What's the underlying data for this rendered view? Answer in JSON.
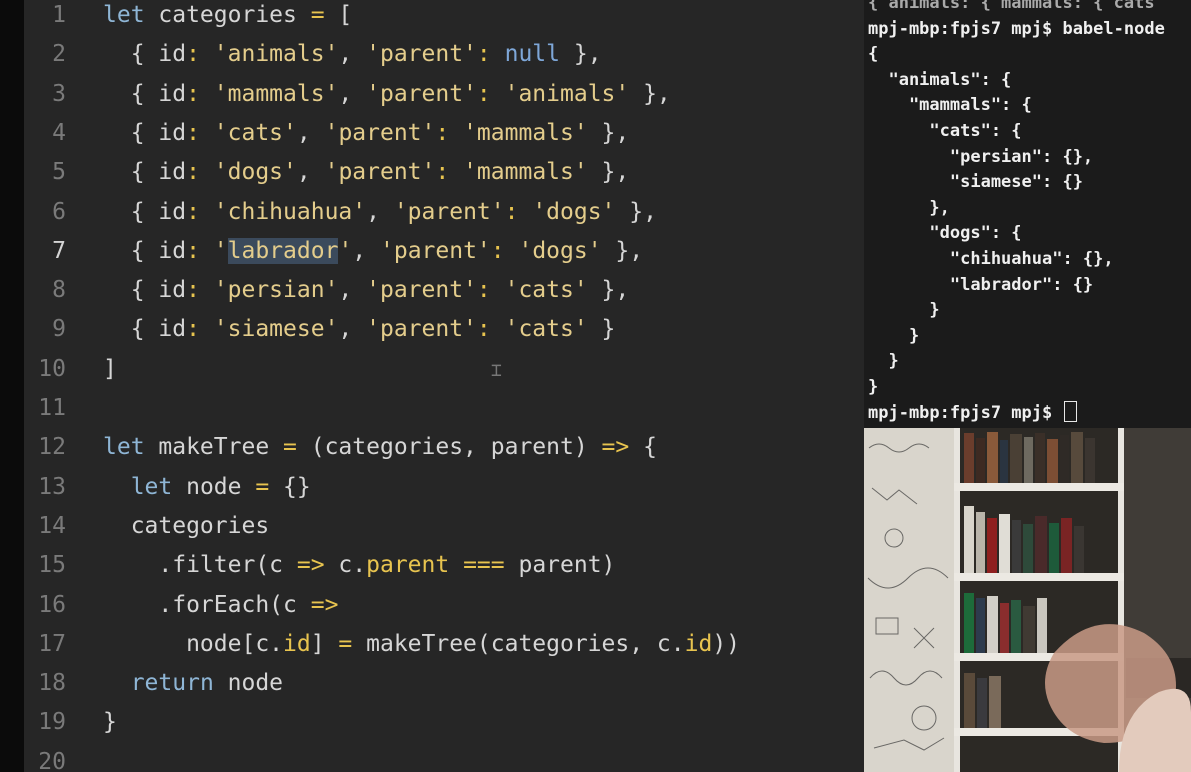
{
  "editor": {
    "active_line": 7,
    "lines": [
      {
        "n": "1",
        "tokens": [
          [
            "let",
            "kw"
          ],
          [
            " categories ",
            "id"
          ],
          [
            "=",
            "op"
          ],
          [
            " [",
            "punc"
          ]
        ]
      },
      {
        "n": "2",
        "tokens": [
          [
            "  { ",
            "punc"
          ],
          [
            "id",
            "prop"
          ],
          [
            ": ",
            "op"
          ],
          [
            "'animals'",
            "str"
          ],
          [
            ", ",
            "punc"
          ],
          [
            "'parent'",
            "str"
          ],
          [
            ": ",
            "op"
          ],
          [
            "null",
            "null"
          ],
          [
            " },",
            "punc"
          ]
        ]
      },
      {
        "n": "3",
        "tokens": [
          [
            "  { ",
            "punc"
          ],
          [
            "id",
            "prop"
          ],
          [
            ": ",
            "op"
          ],
          [
            "'mammals'",
            "str"
          ],
          [
            ", ",
            "punc"
          ],
          [
            "'parent'",
            "str"
          ],
          [
            ": ",
            "op"
          ],
          [
            "'animals'",
            "str"
          ],
          [
            " },",
            "punc"
          ]
        ]
      },
      {
        "n": "4",
        "tokens": [
          [
            "  { ",
            "punc"
          ],
          [
            "id",
            "prop"
          ],
          [
            ": ",
            "op"
          ],
          [
            "'cats'",
            "str"
          ],
          [
            ", ",
            "punc"
          ],
          [
            "'parent'",
            "str"
          ],
          [
            ": ",
            "op"
          ],
          [
            "'mammals'",
            "str"
          ],
          [
            " },",
            "punc"
          ]
        ]
      },
      {
        "n": "5",
        "tokens": [
          [
            "  { ",
            "punc"
          ],
          [
            "id",
            "prop"
          ],
          [
            ": ",
            "op"
          ],
          [
            "'dogs'",
            "str"
          ],
          [
            ", ",
            "punc"
          ],
          [
            "'parent'",
            "str"
          ],
          [
            ": ",
            "op"
          ],
          [
            "'mammals'",
            "str"
          ],
          [
            " },",
            "punc"
          ]
        ]
      },
      {
        "n": "6",
        "tokens": [
          [
            "  { ",
            "punc"
          ],
          [
            "id",
            "prop"
          ],
          [
            ": ",
            "op"
          ],
          [
            "'chihuahua'",
            "str"
          ],
          [
            ", ",
            "punc"
          ],
          [
            "'parent'",
            "str"
          ],
          [
            ": ",
            "op"
          ],
          [
            "'dogs'",
            "str"
          ],
          [
            " },",
            "punc"
          ]
        ]
      },
      {
        "n": "7",
        "tokens": [
          [
            "  { ",
            "punc"
          ],
          [
            "id",
            "prop"
          ],
          [
            ": ",
            "op"
          ],
          [
            "'",
            "str"
          ],
          [
            "labrador",
            "sel"
          ],
          [
            "'",
            "str"
          ],
          [
            ", ",
            "punc"
          ],
          [
            "'parent'",
            "str"
          ],
          [
            ": ",
            "op"
          ],
          [
            "'dogs'",
            "str"
          ],
          [
            " },",
            "punc"
          ]
        ]
      },
      {
        "n": "8",
        "tokens": [
          [
            "  { ",
            "punc"
          ],
          [
            "id",
            "prop"
          ],
          [
            ": ",
            "op"
          ],
          [
            "'persian'",
            "str"
          ],
          [
            ", ",
            "punc"
          ],
          [
            "'parent'",
            "str"
          ],
          [
            ": ",
            "op"
          ],
          [
            "'cats'",
            "str"
          ],
          [
            " },",
            "punc"
          ]
        ]
      },
      {
        "n": "9",
        "tokens": [
          [
            "  { ",
            "punc"
          ],
          [
            "id",
            "prop"
          ],
          [
            ": ",
            "op"
          ],
          [
            "'siamese'",
            "str"
          ],
          [
            ", ",
            "punc"
          ],
          [
            "'parent'",
            "str"
          ],
          [
            ": ",
            "op"
          ],
          [
            "'cats'",
            "str"
          ],
          [
            " }",
            "punc"
          ]
        ]
      },
      {
        "n": "10",
        "tokens": [
          [
            "]",
            "punc"
          ]
        ]
      },
      {
        "n": "11",
        "tokens": []
      },
      {
        "n": "12",
        "tokens": [
          [
            "let",
            "kw"
          ],
          [
            " makeTree ",
            "id"
          ],
          [
            "=",
            "op"
          ],
          [
            " (categories, parent) ",
            "id"
          ],
          [
            "=>",
            "op"
          ],
          [
            " {",
            "punc"
          ]
        ]
      },
      {
        "n": "13",
        "tokens": [
          [
            "  ",
            "id"
          ],
          [
            "let",
            "kw"
          ],
          [
            " node ",
            "id"
          ],
          [
            "=",
            "op"
          ],
          [
            " {}",
            "punc"
          ]
        ]
      },
      {
        "n": "14",
        "tokens": [
          [
            "  categories",
            "id"
          ]
        ]
      },
      {
        "n": "15",
        "tokens": [
          [
            "    .filter(c ",
            "id"
          ],
          [
            "=>",
            "op"
          ],
          [
            " c.",
            "id"
          ],
          [
            "parent",
            "mem"
          ],
          [
            " ",
            "id"
          ],
          [
            "===",
            "op"
          ],
          [
            " parent)",
            "id"
          ]
        ]
      },
      {
        "n": "16",
        "tokens": [
          [
            "    .forEach(c ",
            "id"
          ],
          [
            "=>",
            "op"
          ]
        ]
      },
      {
        "n": "17",
        "tokens": [
          [
            "      node[c.",
            "id"
          ],
          [
            "id",
            "mem"
          ],
          [
            "] ",
            "id"
          ],
          [
            "=",
            "op"
          ],
          [
            " makeTree(categories, c.",
            "id"
          ],
          [
            "id",
            "mem"
          ],
          [
            "))",
            "id"
          ]
        ]
      },
      {
        "n": "18",
        "tokens": [
          [
            "  ",
            "id"
          ],
          [
            "return",
            "kw"
          ],
          [
            " node",
            "id"
          ]
        ]
      },
      {
        "n": "19",
        "tokens": [
          [
            "}",
            "punc"
          ]
        ]
      },
      {
        "n": "20",
        "tokens": []
      }
    ]
  },
  "terminal": {
    "lines": [
      {
        "text": "{ animals: { mammals: { cats",
        "dim": true
      },
      {
        "text": "mpj-mbp:fpjs7 mpj$ babel-node"
      },
      {
        "text": "{"
      },
      {
        "text": "  \"animals\": {"
      },
      {
        "text": "    \"mammals\": {"
      },
      {
        "text": "      \"cats\": {"
      },
      {
        "text": "        \"persian\": {},"
      },
      {
        "text": "        \"siamese\": {}"
      },
      {
        "text": "      },"
      },
      {
        "text": "      \"dogs\": {"
      },
      {
        "text": "        \"chihuahua\": {},"
      },
      {
        "text": "        \"labrador\": {}"
      },
      {
        "text": "      }"
      },
      {
        "text": "    }"
      },
      {
        "text": "  }"
      },
      {
        "text": "}"
      },
      {
        "text": "mpj-mbp:fpjs7 mpj$ ",
        "cursor": true
      }
    ]
  },
  "webcam": {
    "label": ""
  }
}
